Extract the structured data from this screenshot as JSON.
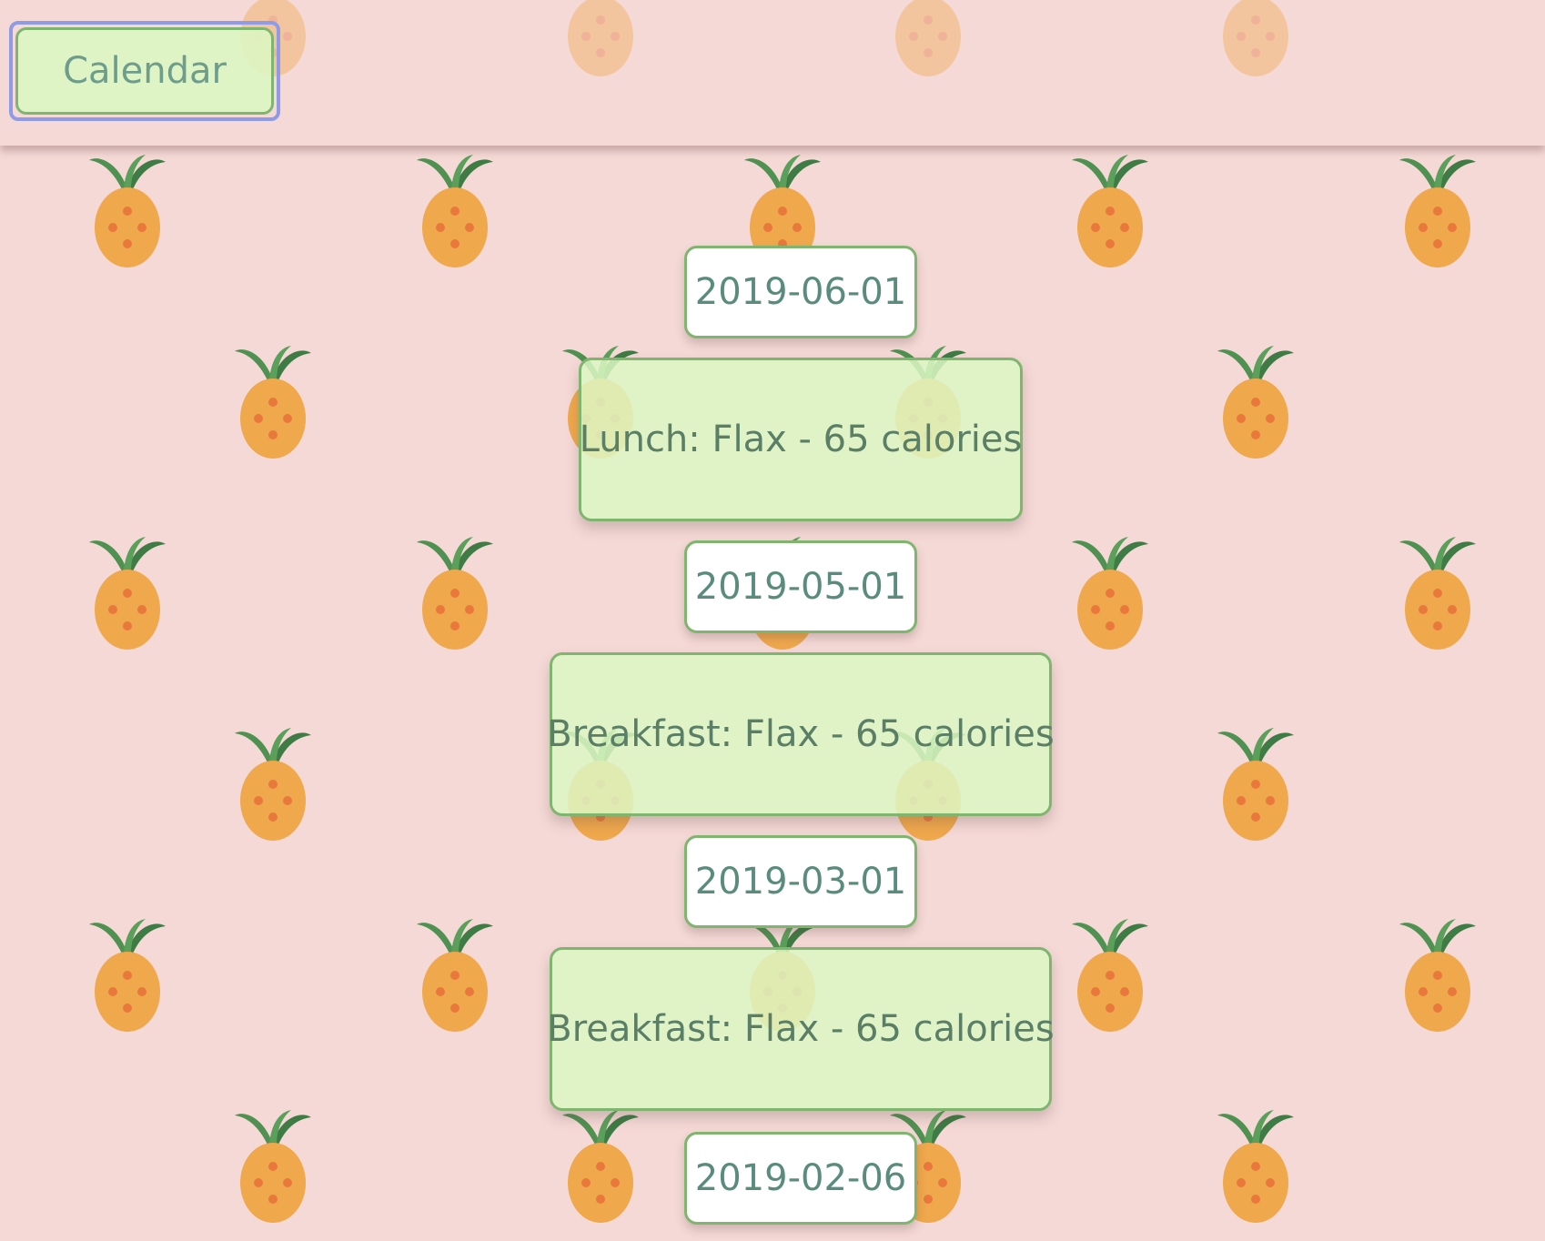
{
  "header": {
    "calendar_label": "Calendar"
  },
  "timeline": [
    {
      "date": "2019-06-01",
      "meal": "Lunch: Flax - 65 calories"
    },
    {
      "date": "2019-05-01",
      "meal": "Breakfast: Flax - 65 calories"
    },
    {
      "date": "2019-03-01",
      "meal": "Breakfast: Flax - 65 calories"
    },
    {
      "date": "2019-02-06",
      "meal": ""
    }
  ],
  "colors": {
    "background": "#f5d9d6",
    "card_fill": "#dcf7c3",
    "card_border": "#7fb56e",
    "text": "#5a8c7e",
    "focus_ring": "#8f9be6",
    "pineapple_body": "#f0a84c",
    "pineapple_leaf": "#4f9150"
  },
  "background_pattern": "pineapple-icon"
}
